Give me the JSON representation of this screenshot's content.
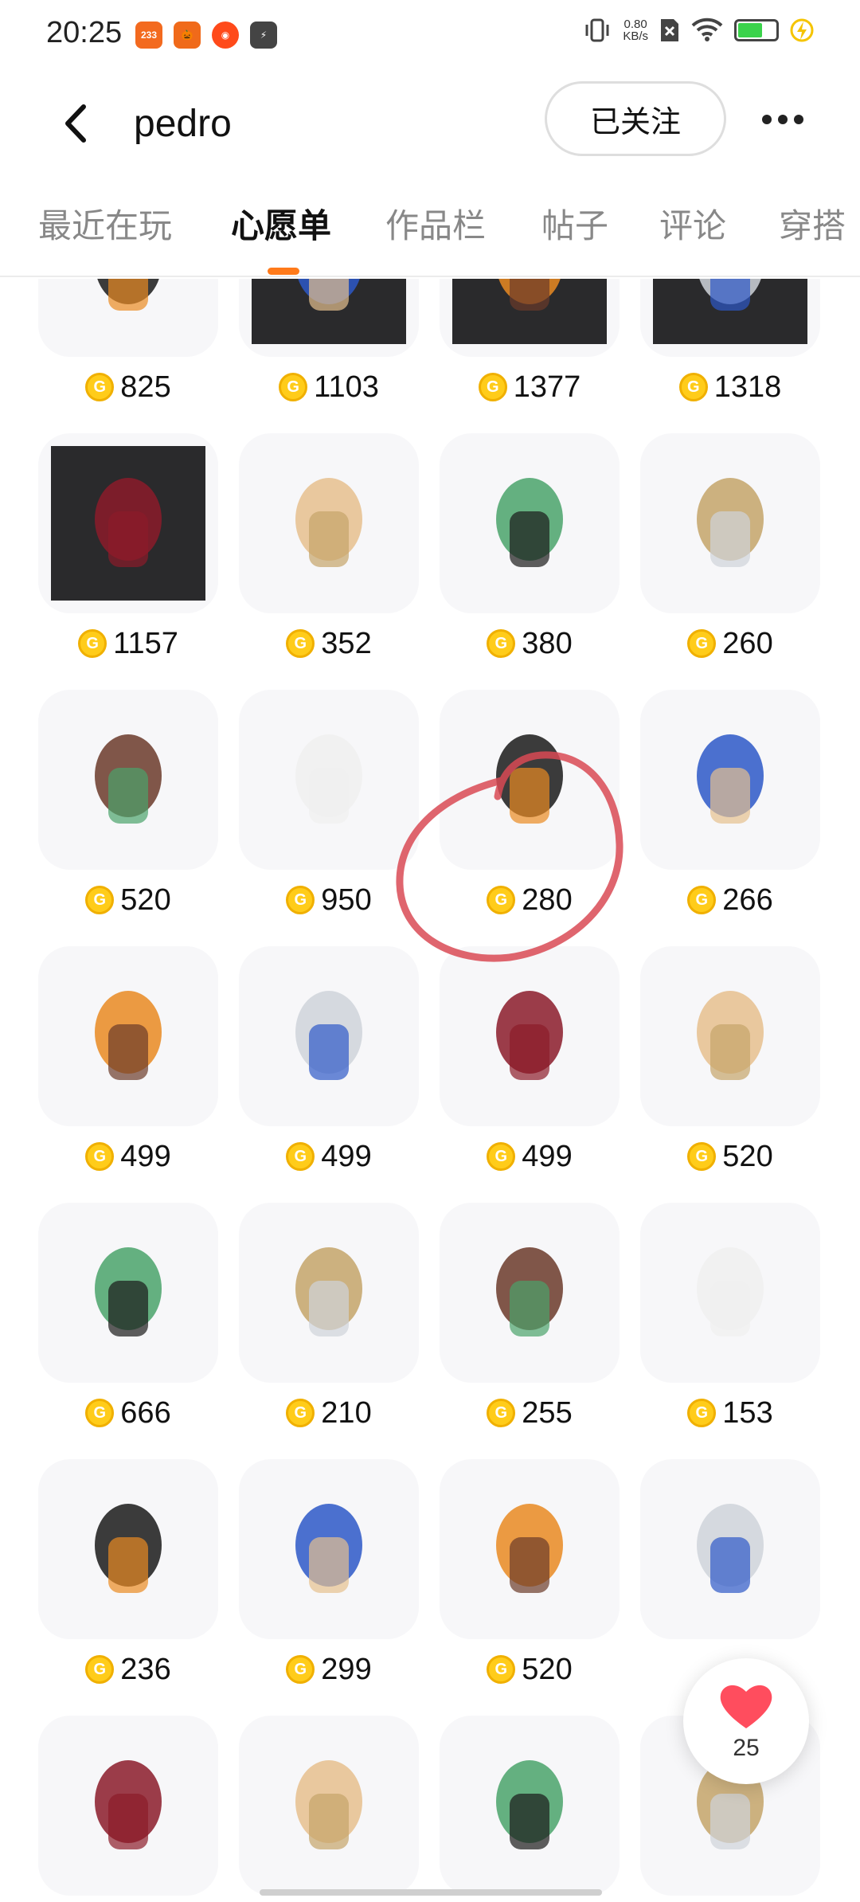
{
  "status_bar": {
    "time": "20:25",
    "apps": [
      {
        "icon": "app-233-icon",
        "label": "233",
        "color": "#f36a1f"
      },
      {
        "icon": "pumpkin-icon",
        "label": "",
        "color": "#f06a1a"
      },
      {
        "icon": "taobao-icon",
        "label": "",
        "color": "#ff4a1a"
      },
      {
        "icon": "bolt-app-icon",
        "label": "",
        "color": "#444444"
      }
    ],
    "net_speed": "0.80",
    "net_unit": "KB/s",
    "battery_color": "#3ad34b"
  },
  "header": {
    "username": "pedro",
    "follow_label": "已关注"
  },
  "tabs": [
    {
      "label": "最近在玩",
      "active": false
    },
    {
      "label": "心愿单",
      "active": true
    },
    {
      "label": "作品栏",
      "active": false
    },
    {
      "label": "帖子",
      "active": false
    },
    {
      "label": "评论",
      "active": false
    },
    {
      "label": "穿搭",
      "active": false
    }
  ],
  "accent_color": "#ff7a1a",
  "coin_symbol": "G",
  "items": [
    {
      "name": "black-gothic-dress",
      "price": "825",
      "dark": false
    },
    {
      "name": "mecha-helmet",
      "price": "1103",
      "dark": true
    },
    {
      "name": "mecha-armor",
      "price": "1377",
      "dark": true
    },
    {
      "name": "mecha-boots",
      "price": "1318",
      "dark": true
    },
    {
      "name": "mecha-gauntlet",
      "price": "1157",
      "dark": true
    },
    {
      "name": "black-chain-pants",
      "price": "352",
      "dark": false
    },
    {
      "name": "silver-red-horn-hair",
      "price": "380",
      "dark": false
    },
    {
      "name": "black-red-boots",
      "price": "260",
      "dark": false
    },
    {
      "name": "red-black-jacket",
      "price": "520",
      "dark": false
    },
    {
      "name": "fox-pet",
      "price": "950",
      "dark": false
    },
    {
      "name": "rose-scythe",
      "price": "280",
      "dark": false
    },
    {
      "name": "fingerless-glove",
      "price": "266",
      "dark": false
    },
    {
      "name": "white-long-hair",
      "price": "499",
      "dark": false
    },
    {
      "name": "black-twin-tail-hair",
      "price": "499",
      "dark": false
    },
    {
      "name": "silver-braid-hair",
      "price": "499",
      "dark": false
    },
    {
      "name": "white-lace-gown",
      "price": "520",
      "dark": false
    },
    {
      "name": "magic-circle",
      "price": "666",
      "dark": false
    },
    {
      "name": "black-glove",
      "price": "210",
      "dark": false
    },
    {
      "name": "black-scythe",
      "price": "255",
      "dark": false
    },
    {
      "name": "green-kimono",
      "price": "153",
      "dark": false
    },
    {
      "name": "red-blazer",
      "price": "236",
      "dark": false
    },
    {
      "name": "white-ruffle-top",
      "price": "299",
      "dark": false
    },
    {
      "name": "lace-bridal-dress",
      "price": "520",
      "dark": false
    },
    {
      "name": "orange-hair-goggles",
      "price": "",
      "dark": false
    },
    {
      "name": "yellow-hoodie",
      "price": "",
      "dark": false
    },
    {
      "name": "yellow-shorts",
      "price": "",
      "dark": false
    },
    {
      "name": "white-boots",
      "price": "",
      "dark": false
    },
    {
      "name": "auburn-hair",
      "price": "",
      "dark": false
    }
  ],
  "like_fab": {
    "count": "25",
    "heart_color": "#ff4d5e"
  }
}
